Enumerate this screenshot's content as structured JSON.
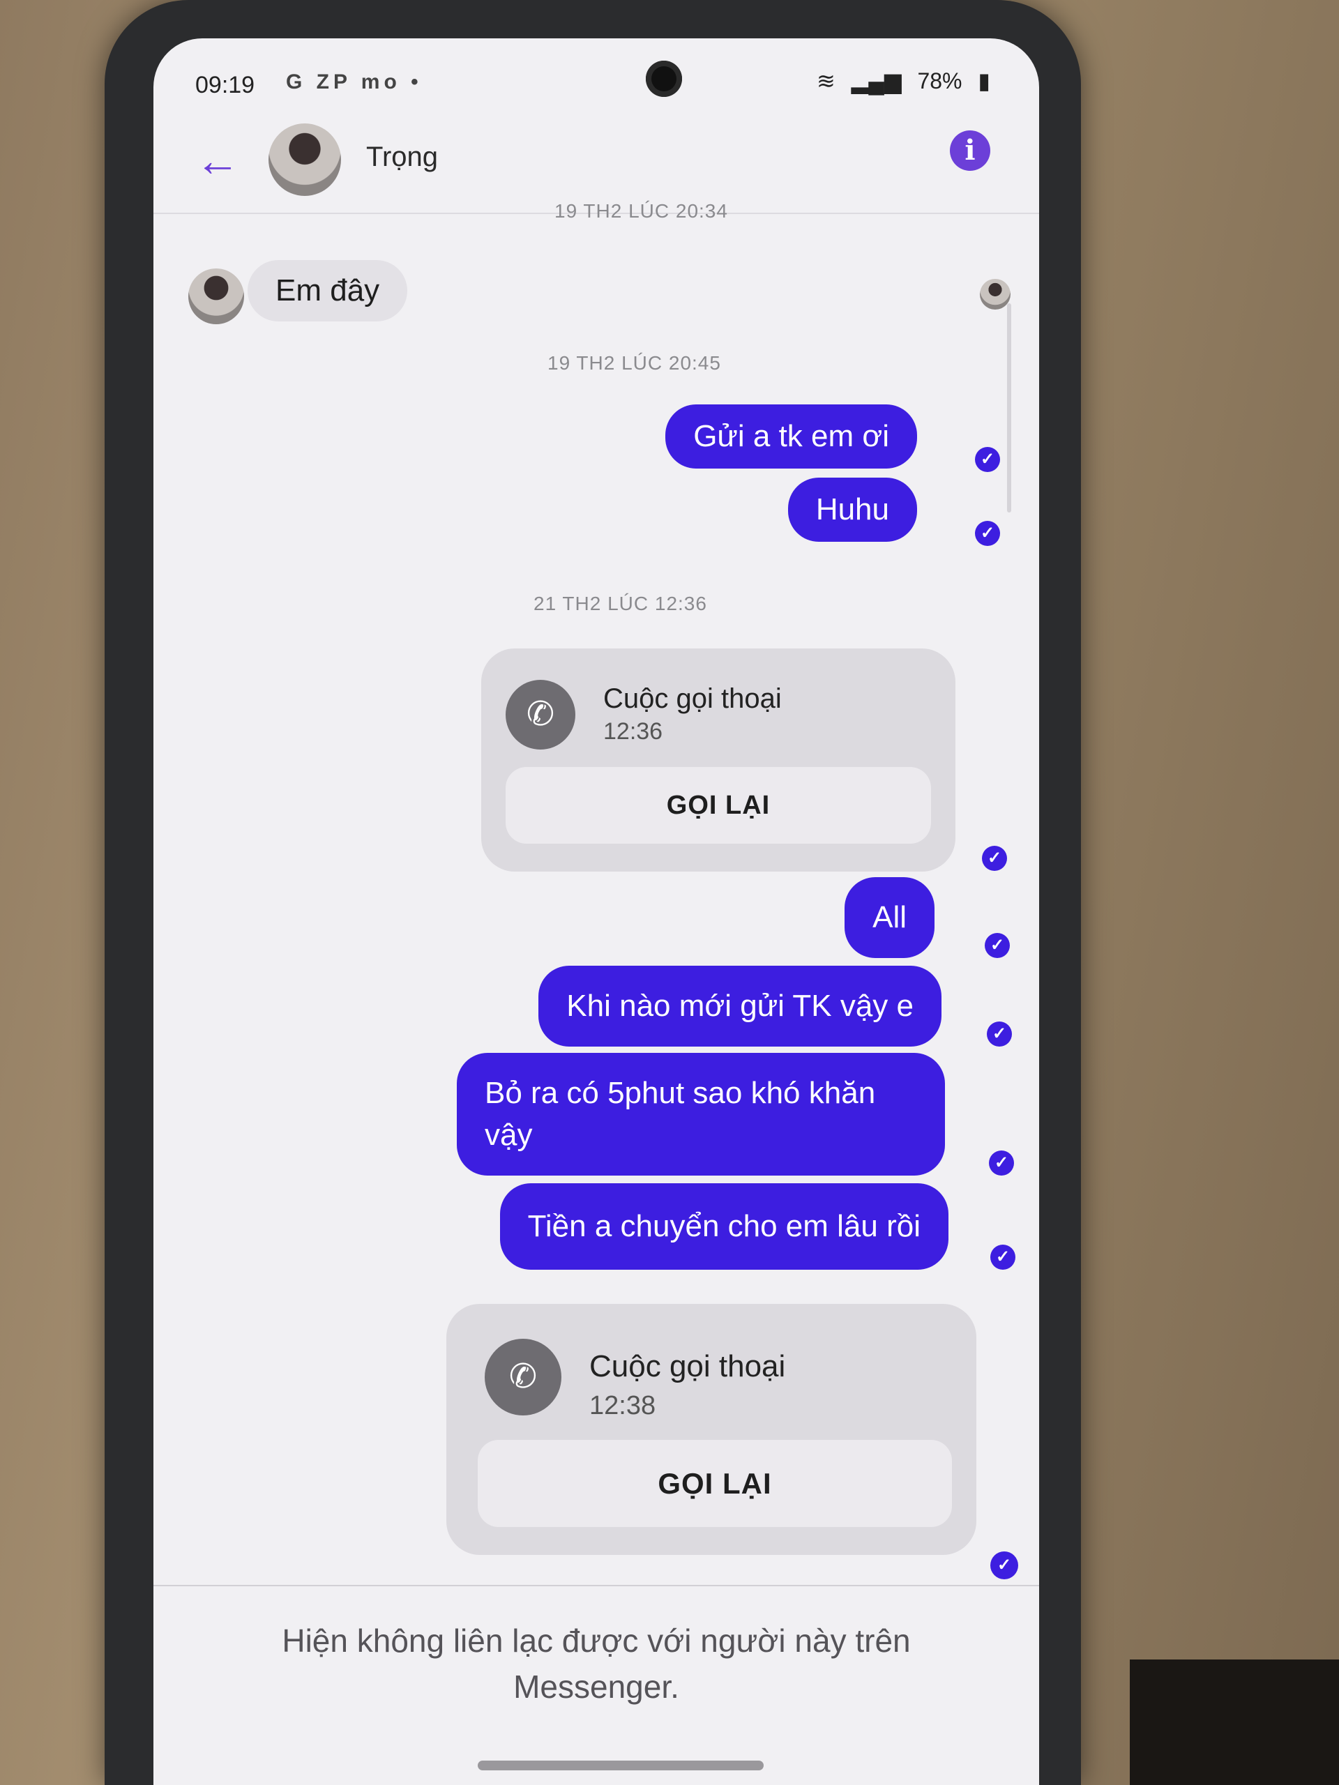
{
  "status_bar": {
    "time": "09:19",
    "left_icons": "G ZP mo •",
    "battery": "78%"
  },
  "header": {
    "contact_name": "Trọng",
    "back_icon": "arrow-left-icon",
    "info_icon": "info-icon"
  },
  "messages": {
    "ts1": "19 TH2 LÚC 20:34",
    "msg1": "Em đây",
    "ts2": "19 TH2 LÚC 20:45",
    "msg2": "Gửi a tk em ơi",
    "msg3": "Huhu",
    "ts3": "21 TH2 LÚC 12:36",
    "call1": {
      "title": "Cuộc gọi thoại",
      "time": "12:36",
      "button": "GỌI LẠI"
    },
    "msg4": "All",
    "msg5": "Khi nào mới gửi TK vậy e",
    "msg6": "Bỏ ra có 5phut sao khó khăn vậy",
    "msg7": "Tiền a chuyển cho em lâu rồi",
    "call2": {
      "title": "Cuộc gọi thoại",
      "time": "12:38",
      "button": "GỌI LẠI"
    }
  },
  "footer": {
    "notice": "Hiện không liên lạc được với người này trên Messenger."
  },
  "colors": {
    "accent": "#6c3fd8",
    "outgoing_bubble": "#3d1ee0",
    "incoming_bubble": "#e3e1e6"
  }
}
